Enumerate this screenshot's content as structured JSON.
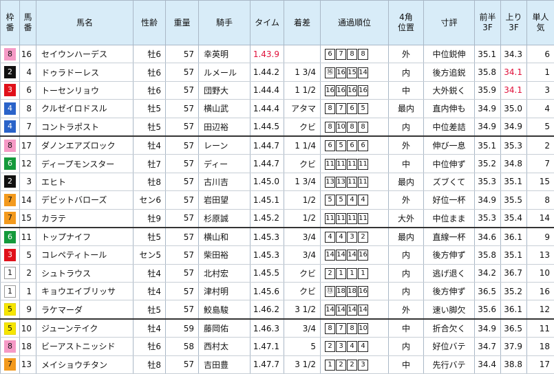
{
  "headers": {
    "waku": "枠\n番",
    "umaban": "馬\n番",
    "name": "馬名",
    "age": "性齢",
    "weight": "重量",
    "jockey": "騎手",
    "time": "タイム",
    "margin": "着差",
    "passing": "通過順位",
    "corner4": "4角\n位置",
    "comment": "寸評",
    "first3f": "前半\n3F",
    "last3f": "上り\n3F",
    "pop": "単人\n気"
  },
  "waku_colors": {
    "1": {
      "bg": "#ffffff",
      "fg": "#111111",
      "border": "#999999"
    },
    "2": {
      "bg": "#111111",
      "fg": "#ffffff",
      "border": "#111111"
    },
    "3": {
      "bg": "#e0101a",
      "fg": "#ffffff",
      "border": "#e0101a"
    },
    "4": {
      "bg": "#2a63c9",
      "fg": "#ffffff",
      "border": "#2a63c9"
    },
    "5": {
      "bg": "#f6e600",
      "fg": "#111111",
      "border": "#e4d400"
    },
    "6": {
      "bg": "#149a3c",
      "fg": "#ffffff",
      "border": "#149a3c"
    },
    "7": {
      "bg": "#f39a1e",
      "fg": "#111111",
      "border": "#f39a1e"
    },
    "8": {
      "bg": "#f59ac6",
      "fg": "#111111",
      "border": "#f59ac6"
    }
  },
  "highlight_color": "#e0103a",
  "rows": [
    {
      "waku": "8",
      "ban": "16",
      "name": "セイウンハーデス",
      "age": "牡6",
      "wt": "57",
      "jockey": "幸英明",
      "time": "1.43.9",
      "time_hi": true,
      "margin": "",
      "pos": [
        "6",
        "7",
        "8",
        "8"
      ],
      "c4": "外",
      "comment": "中位鋭伸",
      "f3": "35.1",
      "l3": "34.3",
      "l3_hi": false,
      "pop": "6",
      "sep": false
    },
    {
      "waku": "2",
      "ban": "4",
      "name": "ドゥラドーレス",
      "age": "牡6",
      "wt": "57",
      "jockey": "ルメール",
      "time": "1.44.2",
      "time_hi": false,
      "margin": "1 3/4",
      "pos": [
        "⑯",
        "16",
        "15",
        "14"
      ],
      "c4": "内",
      "comment": "後方追鋭",
      "f3": "35.8",
      "l3": "34.1",
      "l3_hi": true,
      "pop": "1",
      "sep": false
    },
    {
      "waku": "3",
      "ban": "6",
      "name": "トーセンリョウ",
      "age": "牡6",
      "wt": "57",
      "jockey": "団野大",
      "time": "1.44.4",
      "time_hi": false,
      "margin": "1 1/2",
      "pos": [
        "16",
        "16",
        "16",
        "16"
      ],
      "c4": "中",
      "comment": "大外鋭く",
      "f3": "35.9",
      "l3": "34.1",
      "l3_hi": true,
      "pop": "3",
      "sep": false
    },
    {
      "waku": "4",
      "ban": "8",
      "name": "クルゼイロドスル",
      "age": "牡5",
      "wt": "57",
      "jockey": "横山武",
      "time": "1.44.4",
      "time_hi": false,
      "margin": "アタマ",
      "pos": [
        "8",
        "7",
        "6",
        "5"
      ],
      "c4": "最内",
      "comment": "直内伸も",
      "f3": "34.9",
      "l3": "35.0",
      "l3_hi": false,
      "pop": "4",
      "sep": false
    },
    {
      "waku": "4",
      "ban": "7",
      "name": "コントラポスト",
      "age": "牡5",
      "wt": "57",
      "jockey": "田辺裕",
      "time": "1.44.5",
      "time_hi": false,
      "margin": "クビ",
      "pos": [
        "8",
        "10",
        "8",
        "8"
      ],
      "c4": "内",
      "comment": "中位差詰",
      "f3": "34.9",
      "l3": "34.9",
      "l3_hi": false,
      "pop": "5",
      "sep": false
    },
    {
      "waku": "8",
      "ban": "17",
      "name": "ダノンエアズロック",
      "age": "牡4",
      "wt": "57",
      "jockey": "レーン",
      "time": "1.44.7",
      "time_hi": false,
      "margin": "1 1/4",
      "pos": [
        "6",
        "5",
        "6",
        "6"
      ],
      "c4": "外",
      "comment": "伸び一息",
      "f3": "35.1",
      "l3": "35.3",
      "l3_hi": false,
      "pop": "2",
      "sep": true
    },
    {
      "waku": "6",
      "ban": "12",
      "name": "ディープモンスター",
      "age": "牡7",
      "wt": "57",
      "jockey": "ディー",
      "time": "1.44.7",
      "time_hi": false,
      "margin": "クビ",
      "pos": [
        "11",
        "11",
        "11",
        "11"
      ],
      "c4": "中",
      "comment": "中位伸ず",
      "f3": "35.2",
      "l3": "34.8",
      "l3_hi": false,
      "pop": "7",
      "sep": false
    },
    {
      "waku": "2",
      "ban": "3",
      "name": "エヒト",
      "age": "牡8",
      "wt": "57",
      "jockey": "古川吉",
      "time": "1.45.0",
      "time_hi": false,
      "margin": "1 3/4",
      "pos": [
        "13",
        "13",
        "11",
        "11"
      ],
      "c4": "最内",
      "comment": "ズブくて",
      "f3": "35.3",
      "l3": "35.1",
      "l3_hi": false,
      "pop": "15",
      "sep": false
    },
    {
      "waku": "7",
      "ban": "14",
      "name": "デビットバローズ",
      "age": "セン6",
      "wt": "57",
      "jockey": "岩田望",
      "time": "1.45.1",
      "time_hi": false,
      "margin": "1/2",
      "pos": [
        "5",
        "5",
        "4",
        "4"
      ],
      "c4": "外",
      "comment": "好位一杯",
      "f3": "34.9",
      "l3": "35.5",
      "l3_hi": false,
      "pop": "8",
      "sep": false
    },
    {
      "waku": "7",
      "ban": "15",
      "name": "カラテ",
      "age": "牡9",
      "wt": "57",
      "jockey": "杉原誠",
      "time": "1.45.2",
      "time_hi": false,
      "margin": "1/2",
      "pos": [
        "11",
        "11",
        "11",
        "11"
      ],
      "c4": "大外",
      "comment": "中位まま",
      "f3": "35.3",
      "l3": "35.4",
      "l3_hi": false,
      "pop": "14",
      "sep": false
    },
    {
      "waku": "6",
      "ban": "11",
      "name": "トップナイフ",
      "age": "牡5",
      "wt": "57",
      "jockey": "横山和",
      "time": "1.45.3",
      "time_hi": false,
      "margin": "3/4",
      "pos": [
        "4",
        "4",
        "3",
        "2"
      ],
      "c4": "最内",
      "comment": "直線一杯",
      "f3": "34.6",
      "l3": "36.1",
      "l3_hi": false,
      "pop": "9",
      "sep": true
    },
    {
      "waku": "3",
      "ban": "5",
      "name": "コレペティトール",
      "age": "セン5",
      "wt": "57",
      "jockey": "柴田裕",
      "time": "1.45.3",
      "time_hi": false,
      "margin": "3/4",
      "pos": [
        "14",
        "14",
        "14",
        "16"
      ],
      "c4": "内",
      "comment": "後方伸ず",
      "f3": "35.8",
      "l3": "35.1",
      "l3_hi": false,
      "pop": "13",
      "sep": false
    },
    {
      "waku": "1",
      "ban": "2",
      "name": "シュトラウス",
      "age": "牡4",
      "wt": "57",
      "jockey": "北村宏",
      "time": "1.45.5",
      "time_hi": false,
      "margin": "クビ",
      "pos": [
        "2",
        "1",
        "1",
        "1"
      ],
      "c4": "内",
      "comment": "逃げ退く",
      "f3": "34.2",
      "l3": "36.7",
      "l3_hi": false,
      "pop": "10",
      "sep": false
    },
    {
      "waku": "1",
      "ban": "1",
      "name": "キョウエイブリッサ",
      "age": "牡4",
      "wt": "57",
      "jockey": "津村明",
      "time": "1.45.6",
      "time_hi": false,
      "margin": "クビ",
      "pos": [
        "⑬",
        "18",
        "18",
        "16"
      ],
      "c4": "内",
      "comment": "後方伸ず",
      "f3": "36.5",
      "l3": "35.2",
      "l3_hi": false,
      "pop": "16",
      "sep": false
    },
    {
      "waku": "5",
      "ban": "9",
      "name": "ラケマーダ",
      "age": "牡5",
      "wt": "57",
      "jockey": "鮫島駿",
      "time": "1.46.2",
      "time_hi": false,
      "margin": "3 1/2",
      "pos": [
        "14",
        "14",
        "14",
        "14"
      ],
      "c4": "外",
      "comment": "速い脚欠",
      "f3": "35.6",
      "l3": "36.1",
      "l3_hi": false,
      "pop": "12",
      "sep": false
    },
    {
      "waku": "5",
      "ban": "10",
      "name": "ジューンテイク",
      "age": "牡4",
      "wt": "59",
      "jockey": "藤岡佑",
      "time": "1.46.3",
      "time_hi": false,
      "margin": "3/4",
      "pos": [
        "8",
        "7",
        "8",
        "10"
      ],
      "c4": "中",
      "comment": "折合欠く",
      "f3": "34.9",
      "l3": "36.5",
      "l3_hi": false,
      "pop": "11",
      "sep": true
    },
    {
      "waku": "8",
      "ban": "18",
      "name": "ビーアストニッシド",
      "age": "牡6",
      "wt": "58",
      "jockey": "西村太",
      "time": "1.47.1",
      "time_hi": false,
      "margin": "5",
      "pos": [
        "2",
        "3",
        "4",
        "4"
      ],
      "c4": "内",
      "comment": "好位バテ",
      "f3": "34.7",
      "l3": "37.9",
      "l3_hi": false,
      "pop": "18",
      "sep": false
    },
    {
      "waku": "7",
      "ban": "13",
      "name": "メイショウチタン",
      "age": "牡8",
      "wt": "57",
      "jockey": "吉田豊",
      "time": "1.47.7",
      "time_hi": false,
      "margin": "3 1/2",
      "pos": [
        "1",
        "2",
        "2",
        "3"
      ],
      "c4": "中",
      "comment": "先行バテ",
      "f3": "34.4",
      "l3": "38.8",
      "l3_hi": false,
      "pop": "17",
      "sep": false
    }
  ]
}
